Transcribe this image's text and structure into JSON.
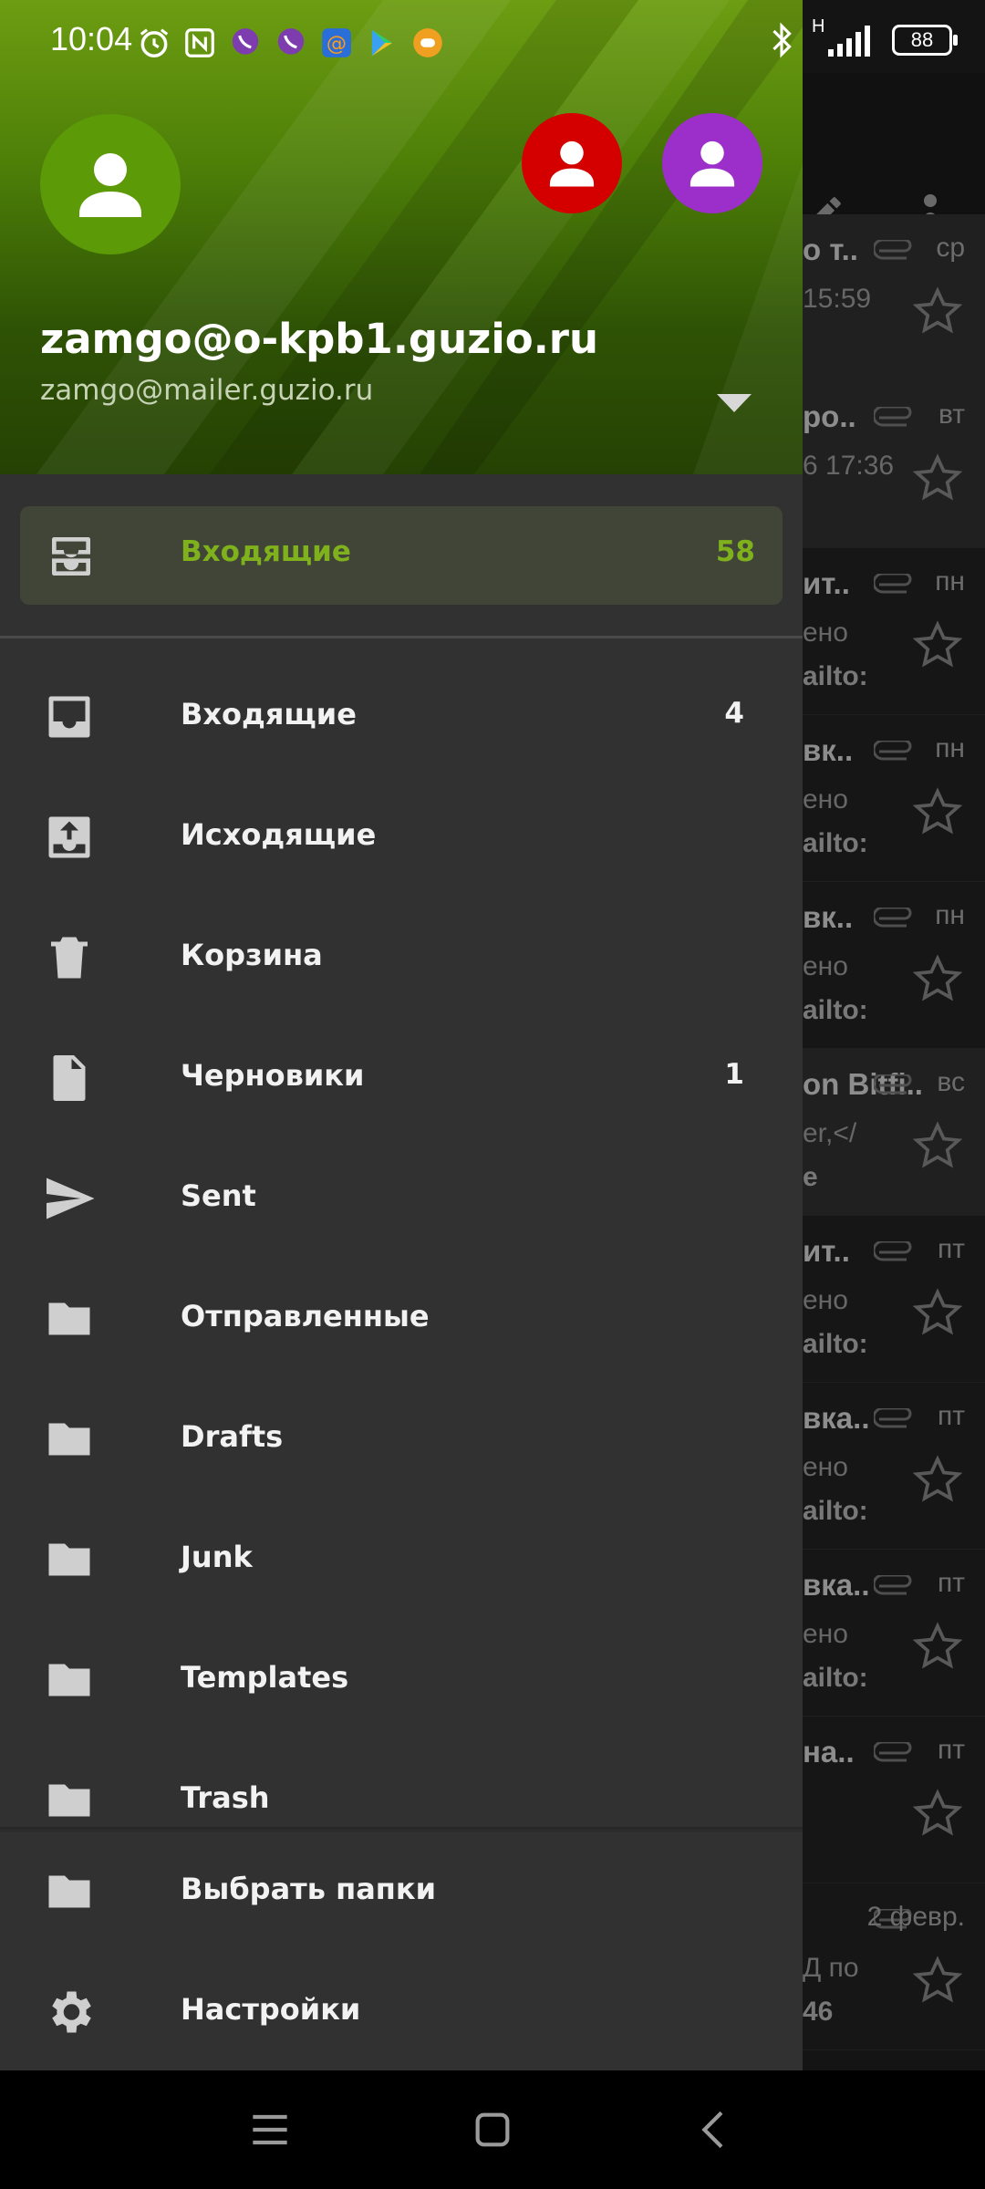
{
  "status_bar": {
    "time": "10:04",
    "battery": "88",
    "network_label": "H"
  },
  "account": {
    "name": "zamgo@o-kpb1.guzio.ru",
    "email": "zamgo@mailer.guzio.ru",
    "avatar_color": "#5c9a08",
    "other_avatars": [
      "#d40000",
      "#9c2ec9"
    ]
  },
  "unified_inbox": {
    "label": "Входящие",
    "count": "58",
    "accent": "#7fb11c"
  },
  "folders": [
    {
      "label": "Входящие",
      "count": "4",
      "icon": "inbox-icon"
    },
    {
      "label": "Исходящие",
      "count": "",
      "icon": "outbox-icon"
    },
    {
      "label": "Корзина",
      "count": "",
      "icon": "trash-icon"
    },
    {
      "label": "Черновики",
      "count": "1",
      "icon": "draft-icon"
    },
    {
      "label": "Sent",
      "count": "",
      "icon": "send-icon"
    },
    {
      "label": "Отправленные",
      "count": "",
      "icon": "folder-icon"
    },
    {
      "label": "Drafts",
      "count": "",
      "icon": "folder-icon"
    },
    {
      "label": "Junk",
      "count": "",
      "icon": "folder-icon"
    },
    {
      "label": "Templates",
      "count": "",
      "icon": "folder-icon"
    },
    {
      "label": "Trash",
      "count": "",
      "icon": "folder-icon"
    }
  ],
  "footer": {
    "choose_folders": "Выбрать папки",
    "settings": "Настройки"
  },
  "background_list": [
    {
      "t1": "о т..",
      "t2": "15:59",
      "t3": "",
      "day": "ср",
      "selected": true
    },
    {
      "t1": "ро..",
      "t2": "6 17:36",
      "t3": "",
      "day": "вт",
      "selected": true
    },
    {
      "t1": "ит..",
      "t2": "ено",
      "t3": "ailto:",
      "day": "пн",
      "selected": false
    },
    {
      "t1": "вк..",
      "t2": "ено",
      "t3": "ailto:",
      "day": "пн",
      "selected": false
    },
    {
      "t1": "вк..",
      "t2": "ено",
      "t3": "ailto:",
      "day": "пн",
      "selected": false
    },
    {
      "t1": "on Bitfi..",
      "t2": "er,</",
      "t3": "е",
      "day": "вс",
      "selected": true
    },
    {
      "t1": "ит..",
      "t2": "ено",
      "t3": "ailto:",
      "day": "пт",
      "selected": false
    },
    {
      "t1": "вка..",
      "t2": "ено",
      "t3": "ailto:",
      "day": "пт",
      "selected": false
    },
    {
      "t1": "вка..",
      "t2": "ено",
      "t3": "ailto:",
      "day": "пт",
      "selected": false
    },
    {
      "t1": "на..",
      "t2": "",
      "t3": "",
      "day": "пт",
      "selected": false
    },
    {
      "t1": "",
      "t2": "Д по",
      "t3": "46",
      "day": "2 февр.",
      "selected": false
    }
  ]
}
